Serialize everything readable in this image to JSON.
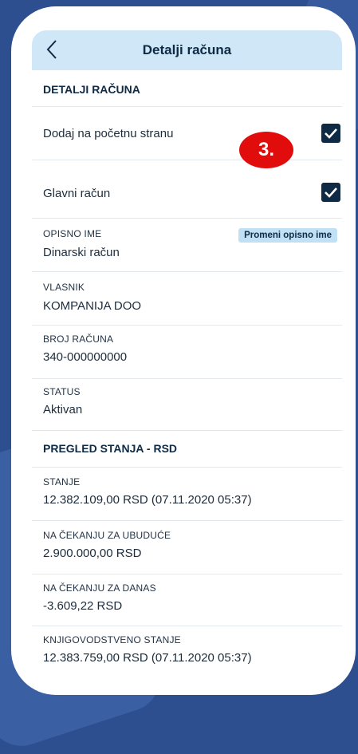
{
  "header": {
    "title": "Detalji računa"
  },
  "details": {
    "section_title": "DETALJI RAČUNA",
    "add_to_home": {
      "label": "Dodaj na početnu stranu",
      "checked": true
    },
    "main_account": {
      "label": "Glavni račun",
      "checked": true
    },
    "descriptive_name": {
      "label": "OPISNO IME",
      "value": "Dinarski račun",
      "action": "Promeni opisno ime"
    },
    "owner": {
      "label": "VLASNIK",
      "value": "KOMPANIJA DOO"
    },
    "account_number": {
      "label": "BROJ RAČUNA",
      "value": "340-000000000"
    },
    "status": {
      "label": "STATUS",
      "value": "Aktivan"
    }
  },
  "balance": {
    "section_title": "PREGLED STANJA - RSD",
    "balance": {
      "label": "STANJE",
      "value": "12.382.109,00 RSD (07.11.2020 05:37)"
    },
    "pending_future": {
      "label": "NA ČEKANJU ZA UBUDUĆE",
      "value": "2.900.000,00 RSD"
    },
    "pending_today": {
      "label": "NA ČEKANJU ZA DANAS",
      "value": "-3.609,22 RSD"
    },
    "book_balance": {
      "label": "KNJIGOVODSTVENO STANJE",
      "value": "12.383.759,00 RSD (07.11.2020 05:37)"
    }
  },
  "step_badge": "3.",
  "colors": {
    "header_bg": "#cfe7f7",
    "primary": "#0e2a45",
    "badge": "#e10d0d",
    "background": "#2d4f8f"
  }
}
